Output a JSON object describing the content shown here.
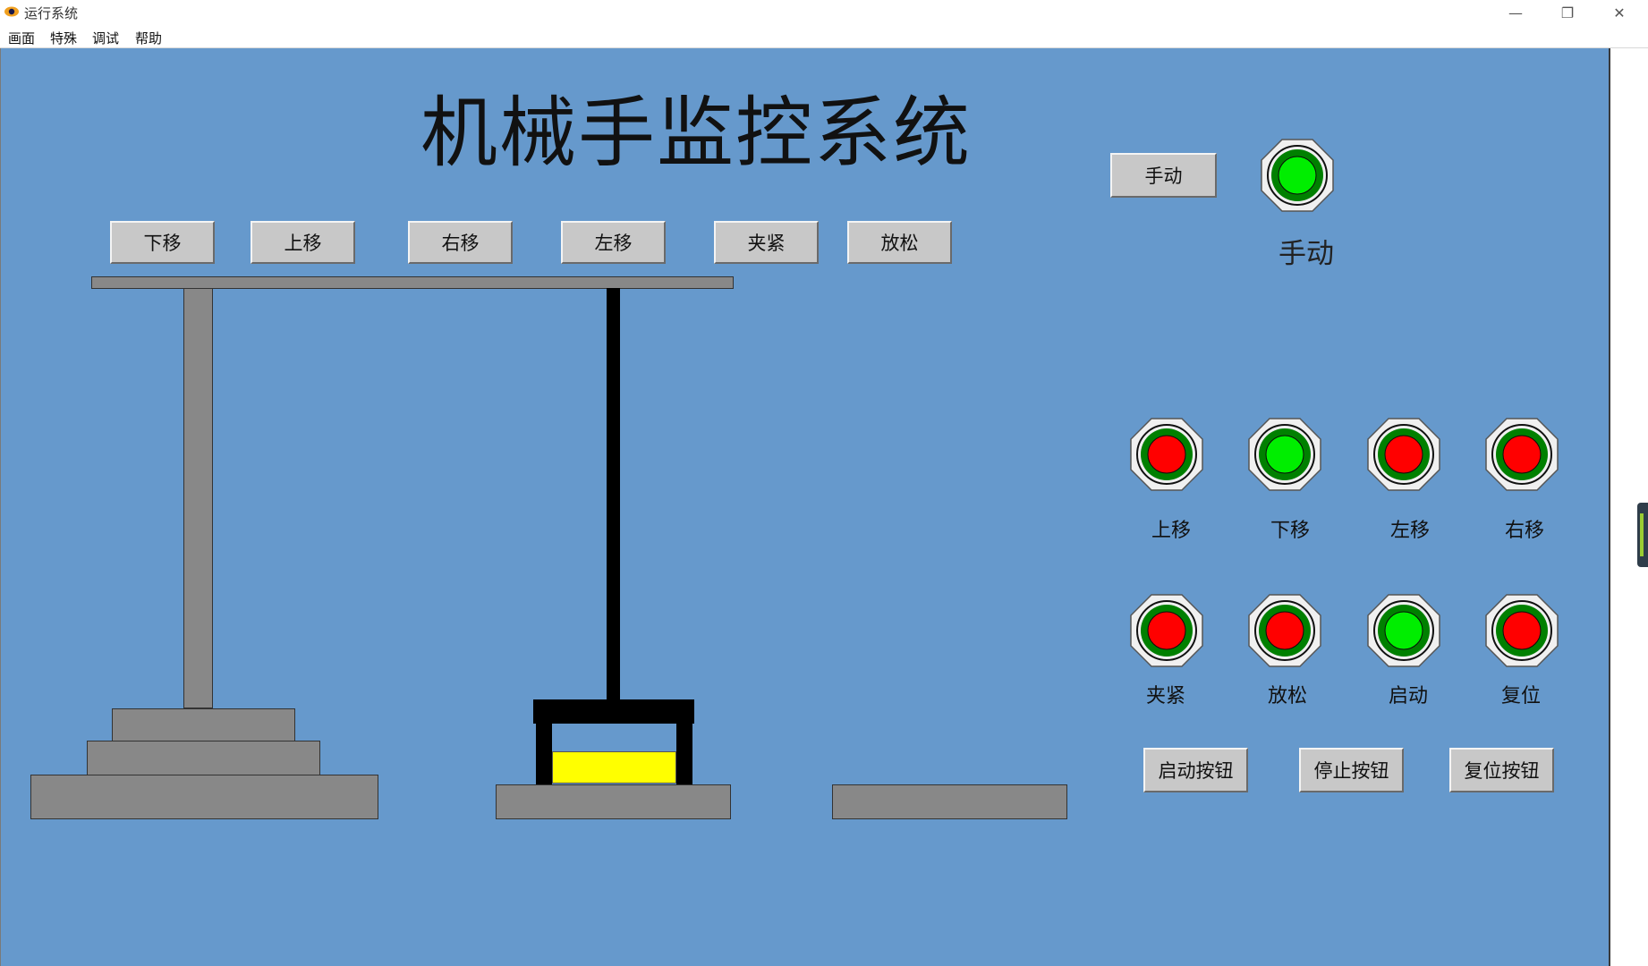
{
  "window": {
    "title": "运行系统",
    "minimize": "—",
    "restore": "❐",
    "close": "✕"
  },
  "menu": [
    "画面",
    "特殊",
    "调试",
    "帮助"
  ],
  "scada": {
    "title": "机械手监控系统",
    "top_buttons": [
      "下移",
      "上移",
      "右移",
      "左移",
      "夹紧",
      "放松"
    ],
    "manual_button": "手动",
    "manual_lamp": {
      "label": "手动",
      "state": "green"
    },
    "indicator_row1": [
      {
        "label": "上移",
        "state": "red"
      },
      {
        "label": "下移",
        "state": "green"
      },
      {
        "label": "左移",
        "state": "red"
      },
      {
        "label": "右移",
        "state": "red"
      }
    ],
    "indicator_row2": [
      {
        "label": "夹紧",
        "state": "red"
      },
      {
        "label": "放松",
        "state": "red"
      },
      {
        "label": "启动",
        "state": "green"
      },
      {
        "label": "复位",
        "state": "red"
      }
    ],
    "control_buttons": [
      "启动按钮",
      "停止按钮",
      "复位按钮"
    ]
  },
  "colors": {
    "background": "#6699cc",
    "equipment": "#888888",
    "workpiece": "#ffff00",
    "lamp_on": "#00ee00",
    "lamp_off": "#ff0000",
    "lamp_ring": "#008000"
  }
}
